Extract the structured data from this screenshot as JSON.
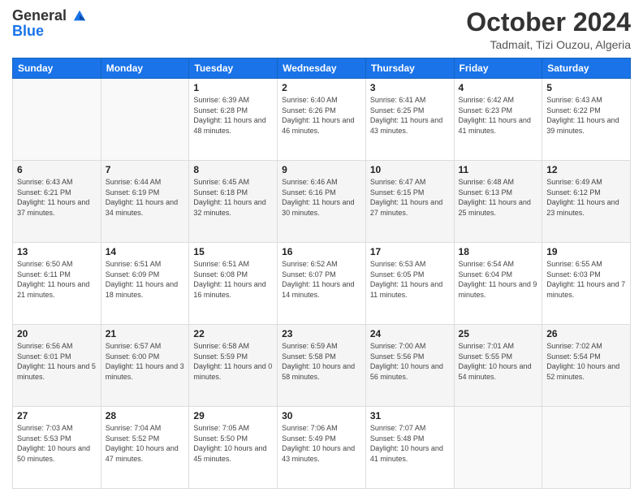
{
  "header": {
    "logo_line1": "General",
    "logo_line2": "Blue",
    "month": "October 2024",
    "location": "Tadmait, Tizi Ouzou, Algeria"
  },
  "calendar": {
    "days_of_week": [
      "Sunday",
      "Monday",
      "Tuesday",
      "Wednesday",
      "Thursday",
      "Friday",
      "Saturday"
    ],
    "weeks": [
      [
        {
          "day": "",
          "info": ""
        },
        {
          "day": "",
          "info": ""
        },
        {
          "day": "1",
          "info": "Sunrise: 6:39 AM\nSunset: 6:28 PM\nDaylight: 11 hours and 48 minutes."
        },
        {
          "day": "2",
          "info": "Sunrise: 6:40 AM\nSunset: 6:26 PM\nDaylight: 11 hours and 46 minutes."
        },
        {
          "day": "3",
          "info": "Sunrise: 6:41 AM\nSunset: 6:25 PM\nDaylight: 11 hours and 43 minutes."
        },
        {
          "day": "4",
          "info": "Sunrise: 6:42 AM\nSunset: 6:23 PM\nDaylight: 11 hours and 41 minutes."
        },
        {
          "day": "5",
          "info": "Sunrise: 6:43 AM\nSunset: 6:22 PM\nDaylight: 11 hours and 39 minutes."
        }
      ],
      [
        {
          "day": "6",
          "info": "Sunrise: 6:43 AM\nSunset: 6:21 PM\nDaylight: 11 hours and 37 minutes."
        },
        {
          "day": "7",
          "info": "Sunrise: 6:44 AM\nSunset: 6:19 PM\nDaylight: 11 hours and 34 minutes."
        },
        {
          "day": "8",
          "info": "Sunrise: 6:45 AM\nSunset: 6:18 PM\nDaylight: 11 hours and 32 minutes."
        },
        {
          "day": "9",
          "info": "Sunrise: 6:46 AM\nSunset: 6:16 PM\nDaylight: 11 hours and 30 minutes."
        },
        {
          "day": "10",
          "info": "Sunrise: 6:47 AM\nSunset: 6:15 PM\nDaylight: 11 hours and 27 minutes."
        },
        {
          "day": "11",
          "info": "Sunrise: 6:48 AM\nSunset: 6:13 PM\nDaylight: 11 hours and 25 minutes."
        },
        {
          "day": "12",
          "info": "Sunrise: 6:49 AM\nSunset: 6:12 PM\nDaylight: 11 hours and 23 minutes."
        }
      ],
      [
        {
          "day": "13",
          "info": "Sunrise: 6:50 AM\nSunset: 6:11 PM\nDaylight: 11 hours and 21 minutes."
        },
        {
          "day": "14",
          "info": "Sunrise: 6:51 AM\nSunset: 6:09 PM\nDaylight: 11 hours and 18 minutes."
        },
        {
          "day": "15",
          "info": "Sunrise: 6:51 AM\nSunset: 6:08 PM\nDaylight: 11 hours and 16 minutes."
        },
        {
          "day": "16",
          "info": "Sunrise: 6:52 AM\nSunset: 6:07 PM\nDaylight: 11 hours and 14 minutes."
        },
        {
          "day": "17",
          "info": "Sunrise: 6:53 AM\nSunset: 6:05 PM\nDaylight: 11 hours and 11 minutes."
        },
        {
          "day": "18",
          "info": "Sunrise: 6:54 AM\nSunset: 6:04 PM\nDaylight: 11 hours and 9 minutes."
        },
        {
          "day": "19",
          "info": "Sunrise: 6:55 AM\nSunset: 6:03 PM\nDaylight: 11 hours and 7 minutes."
        }
      ],
      [
        {
          "day": "20",
          "info": "Sunrise: 6:56 AM\nSunset: 6:01 PM\nDaylight: 11 hours and 5 minutes."
        },
        {
          "day": "21",
          "info": "Sunrise: 6:57 AM\nSunset: 6:00 PM\nDaylight: 11 hours and 3 minutes."
        },
        {
          "day": "22",
          "info": "Sunrise: 6:58 AM\nSunset: 5:59 PM\nDaylight: 11 hours and 0 minutes."
        },
        {
          "day": "23",
          "info": "Sunrise: 6:59 AM\nSunset: 5:58 PM\nDaylight: 10 hours and 58 minutes."
        },
        {
          "day": "24",
          "info": "Sunrise: 7:00 AM\nSunset: 5:56 PM\nDaylight: 10 hours and 56 minutes."
        },
        {
          "day": "25",
          "info": "Sunrise: 7:01 AM\nSunset: 5:55 PM\nDaylight: 10 hours and 54 minutes."
        },
        {
          "day": "26",
          "info": "Sunrise: 7:02 AM\nSunset: 5:54 PM\nDaylight: 10 hours and 52 minutes."
        }
      ],
      [
        {
          "day": "27",
          "info": "Sunrise: 7:03 AM\nSunset: 5:53 PM\nDaylight: 10 hours and 50 minutes."
        },
        {
          "day": "28",
          "info": "Sunrise: 7:04 AM\nSunset: 5:52 PM\nDaylight: 10 hours and 47 minutes."
        },
        {
          "day": "29",
          "info": "Sunrise: 7:05 AM\nSunset: 5:50 PM\nDaylight: 10 hours and 45 minutes."
        },
        {
          "day": "30",
          "info": "Sunrise: 7:06 AM\nSunset: 5:49 PM\nDaylight: 10 hours and 43 minutes."
        },
        {
          "day": "31",
          "info": "Sunrise: 7:07 AM\nSunset: 5:48 PM\nDaylight: 10 hours and 41 minutes."
        },
        {
          "day": "",
          "info": ""
        },
        {
          "day": "",
          "info": ""
        }
      ]
    ]
  }
}
